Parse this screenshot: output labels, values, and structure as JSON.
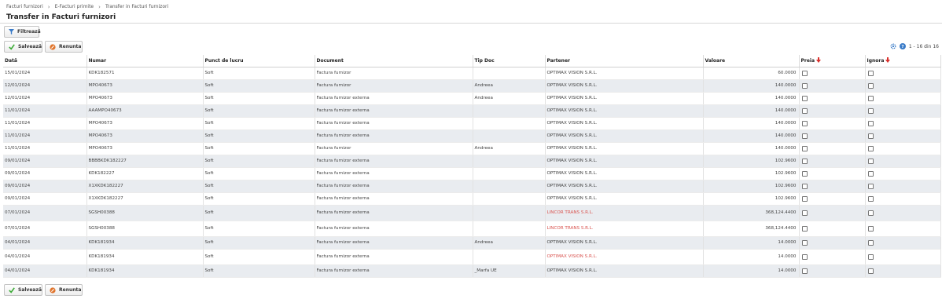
{
  "breadcrumb": [
    "Facturi furnizori",
    "E-Facturi primite",
    "Transfer in Facturi furnizori"
  ],
  "page_title": "Transfer in Facturi furnizori",
  "toolbar": {
    "filter_label": "Filtrează",
    "save_label": "Salvează",
    "cancel_label": "Renunta"
  },
  "pager": {
    "range": "1 - 16 din 16"
  },
  "columns": [
    "Dată",
    "Numar",
    "Punct de lucru",
    "Document",
    "Tip Doc",
    "Partener",
    "Valoare",
    "Preia",
    "Ignora"
  ],
  "colors": {
    "accent": "#3a7bc8",
    "partner_red": "#d9534f",
    "save_green": "#3aaa35",
    "cancel_orange": "#e0752d",
    "arrow_red": "#d9302c"
  },
  "rows": [
    {
      "date": "15/01/2024",
      "number": "KDK182571",
      "location": "Soft",
      "document": "Factura furnizor",
      "tipdoc": "",
      "partner": "OPTIMAX VISION S.R.L.",
      "value": "60.0000",
      "partner_red": false
    },
    {
      "date": "12/01/2024",
      "number": "MPO40673",
      "location": "Soft",
      "document": "Factura furnizor",
      "tipdoc": "Andreea",
      "partner": "OPTIMAX VISION S.R.L.",
      "value": "140.0000",
      "partner_red": false
    },
    {
      "date": "12/01/2024",
      "number": "MPO40673",
      "location": "Soft",
      "document": "Factura furnizor externa",
      "tipdoc": "Andreea",
      "partner": "OPTIMAX VISION S.R.L.",
      "value": "140.0000",
      "partner_red": false
    },
    {
      "date": "11/01/2024",
      "number": "AAAMPO40673",
      "location": "Soft",
      "document": "Factura furnizor externa",
      "tipdoc": "",
      "partner": "OPTIMAX VISION S.R.L.",
      "value": "140.0000",
      "partner_red": false
    },
    {
      "date": "11/01/2024",
      "number": "MPO40673",
      "location": "Soft",
      "document": "Factura furnizor externa",
      "tipdoc": "",
      "partner": "OPTIMAX VISION S.R.L.",
      "value": "140.0000",
      "partner_red": false
    },
    {
      "date": "11/01/2024",
      "number": "MPO40673",
      "location": "Soft",
      "document": "Factura furnizor externa",
      "tipdoc": "",
      "partner": "OPTIMAX VISION S.R.L.",
      "value": "140.0000",
      "partner_red": false
    },
    {
      "date": "11/01/2024",
      "number": "MPO40673",
      "location": "Soft",
      "document": "Factura furnizor",
      "tipdoc": "Andreea",
      "partner": "OPTIMAX VISION S.R.L.",
      "value": "140.0000",
      "partner_red": false
    },
    {
      "date": "09/01/2024",
      "number": "BBBBKDK182227",
      "location": "Soft",
      "document": "Factura furnizor externa",
      "tipdoc": "",
      "partner": "OPTIMAX VISION S.R.L.",
      "value": "102.9600",
      "partner_red": false
    },
    {
      "date": "09/01/2024",
      "number": "KDK182227",
      "location": "Soft",
      "document": "Factura furnizor externa",
      "tipdoc": "",
      "partner": "OPTIMAX VISION S.R.L.",
      "value": "102.9600",
      "partner_red": false
    },
    {
      "date": "09/01/2024",
      "number": "X1XKDK182227",
      "location": "Soft",
      "document": "Factura furnizor externa",
      "tipdoc": "",
      "partner": "OPTIMAX VISION S.R.L.",
      "value": "102.9600",
      "partner_red": false
    },
    {
      "date": "09/01/2024",
      "number": "X1XKDK182227",
      "location": "Soft",
      "document": "Factura furnizor externa",
      "tipdoc": "",
      "partner": "OPTIMAX VISION S.R.L.",
      "value": "102.9600",
      "partner_red": false
    },
    {
      "date": "07/01/2024",
      "number": "SGSH00388",
      "location": "Soft",
      "document": "Factura furnizor externa",
      "tipdoc": "",
      "partner": "LINCOR TRANS S.R.L.",
      "value": "368,124.4400",
      "partner_red": true
    },
    {
      "date": "07/01/2024",
      "number": "SGSH00388",
      "location": "Soft",
      "document": "Factura furnizor externa",
      "tipdoc": "",
      "partner": "LINCOR TRANS S.R.L.",
      "value": "368,124.4400",
      "partner_red": true
    },
    {
      "date": "04/01/2024",
      "number": "KDK181934",
      "location": "Soft",
      "document": "Factura furnizor externa",
      "tipdoc": "Andreea",
      "partner": "OPTIMAX VISION S.R.L.",
      "value": "14.0000",
      "partner_red": false
    },
    {
      "date": "04/01/2024",
      "number": "KDK181934",
      "location": "Soft",
      "document": "Factura furnizor externa",
      "tipdoc": "",
      "partner": "OPTIMAX VISION S.R.L.",
      "value": "14.0000",
      "partner_red": true
    },
    {
      "date": "04/01/2024",
      "number": "KDK181934",
      "location": "Soft",
      "document": "Factura furnizor externa",
      "tipdoc": "_Marfa UE",
      "partner": "OPTIMAX VISION S.R.L.",
      "value": "14.0000",
      "partner_red": false
    }
  ]
}
